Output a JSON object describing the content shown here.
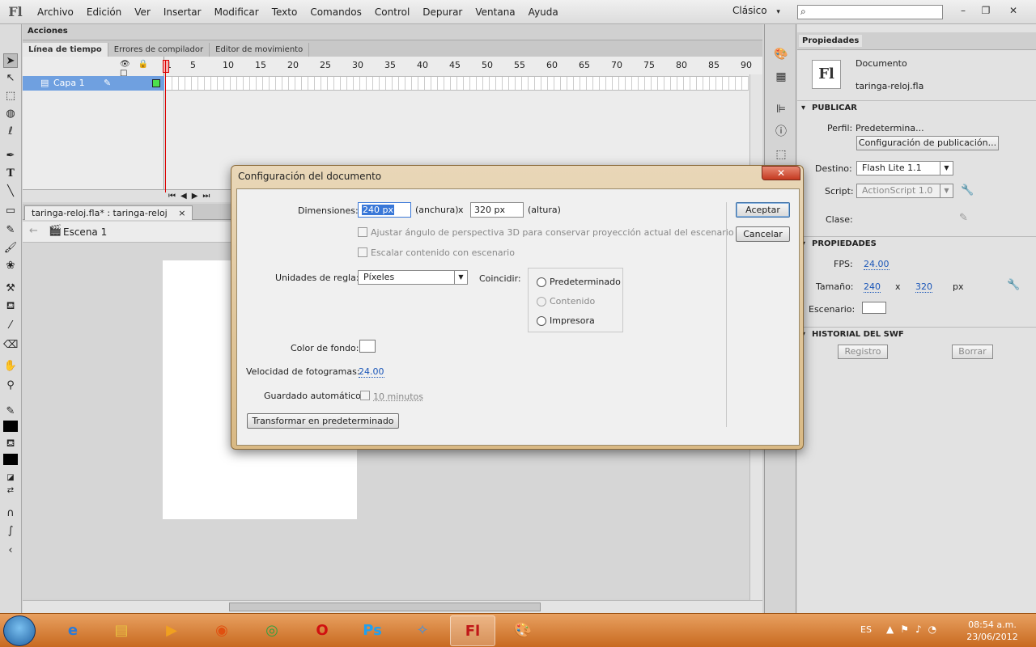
{
  "app": {
    "logo": "Fl",
    "workspace": "Clásico",
    "workspace_arrow": "▾"
  },
  "menu": [
    "Archivo",
    "Edición",
    "Ver",
    "Insertar",
    "Modificar",
    "Texto",
    "Comandos",
    "Control",
    "Depurar",
    "Ventana",
    "Ayuda"
  ],
  "window_controls": {
    "minimize": "–",
    "restore": "❐",
    "close": "✕"
  },
  "actions_panel": {
    "label": "Acciones"
  },
  "timeline": {
    "tabs": [
      "Línea de tiempo",
      "Errores de compilador",
      "Editor de movimiento"
    ],
    "header_icons": "👁🔒□",
    "layer_name": "Capa 1",
    "ruler": [
      "1",
      "5",
      "10",
      "15",
      "20",
      "25",
      "30",
      "35",
      "40",
      "45",
      "50",
      "55",
      "60",
      "65",
      "70",
      "75",
      "80",
      "85",
      "90"
    ],
    "controls": "⏮◀▶⏭"
  },
  "document": {
    "tab_label": "taringa-reloj.fla* : taringa-reloj",
    "tab_close": "×",
    "scene": "Escena 1",
    "back_arrow": "←"
  },
  "properties": {
    "tab": "Propiedades",
    "doc_icon": "Fl",
    "doc_type": "Documento",
    "doc_name": "taringa-reloj.fla",
    "publish_section": "PUBLICAR",
    "profile_label": "Perfil:",
    "profile_value": "Predetermina...",
    "publish_settings_button": "Configuración de publicación...",
    "target_label": "Destino:",
    "target_value": "Flash Lite 1.1",
    "script_label": "Script:",
    "script_value": "ActionScript 1.0",
    "class_label": "Clase:",
    "properties_section": "PROPIEDADES",
    "fps_label": "FPS:",
    "fps_value": "24.00",
    "size_label": "Tamaño:",
    "width_value": "240",
    "size_x": "x",
    "height_value": "320",
    "size_unit": "px",
    "stage_label": "Escenario:",
    "stage_color": "#FFFFFF",
    "swf_history_section": "HISTORIAL DEL SWF",
    "log_button": "Registro",
    "clear_button": "Borrar"
  },
  "dialog": {
    "title": "Configuración del documento",
    "close": "✕",
    "dimensions_label": "Dimensiones:",
    "width_value": "240 px",
    "width_caption": "(anchura)",
    "x": "x",
    "height_value": "320 px",
    "height_caption": "(altura)",
    "perspective_option": "Ajustar ángulo de perspectiva 3D para conservar proyección actual del escenario",
    "scale_option": "Escalar contenido con escenario",
    "ruler_units_label": "Unidades de regla:",
    "ruler_units_value": "Píxeles",
    "match_label": "Coincidir:",
    "match_options": [
      "Predeterminado",
      "Contenido",
      "Impresora"
    ],
    "bg_color_label": "Color de fondo:",
    "bg_color": "#FFFFFF",
    "frame_rate_label": "Velocidad de fotogramas:",
    "frame_rate_value": "24.00",
    "autosave_label": "Guardado automático:",
    "autosave_value": "10 minutos",
    "make_default_button": "Transformar en predeterminado",
    "ok_button": "Aceptar",
    "cancel_button": "Cancelar"
  },
  "taskbar": {
    "language": "ES",
    "time": "08:54 a.m.",
    "date": "23/06/2012",
    "apps": [
      "internet-explorer",
      "file-explorer",
      "media-player",
      "firefox",
      "chrome",
      "opera",
      "photoshop",
      "safari",
      "flash",
      "paint"
    ]
  }
}
